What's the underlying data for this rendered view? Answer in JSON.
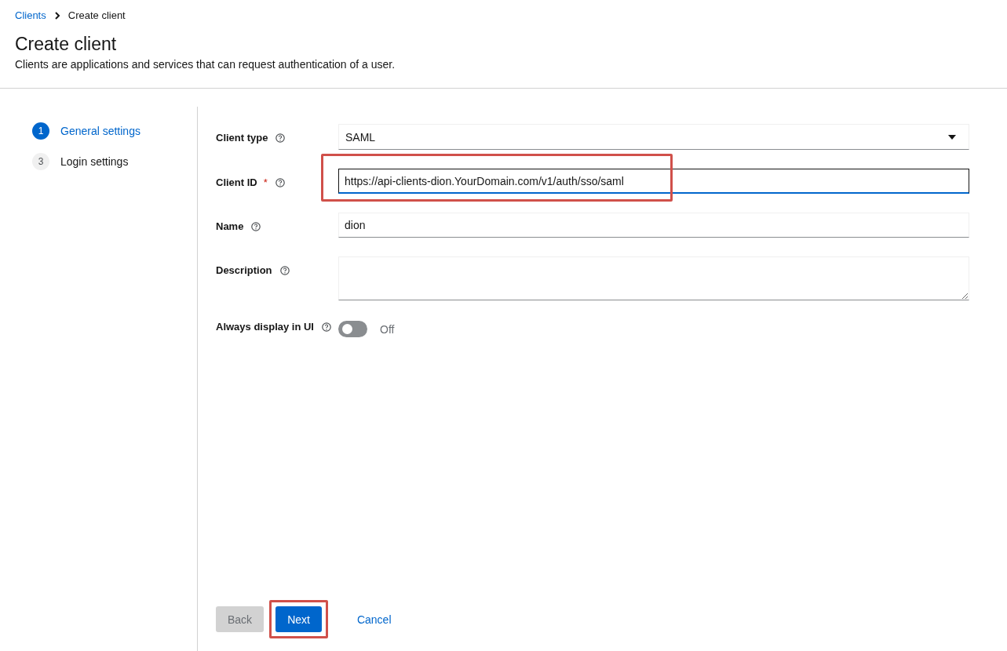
{
  "breadcrumb": [
    {
      "kind": "link",
      "label": "Clients"
    },
    {
      "kind": "current",
      "label": "Create client"
    }
  ],
  "header": {
    "title": "Create client",
    "description": "Clients are applications and services that can request authentication of a user."
  },
  "steps": [
    {
      "number": "1",
      "label": "General settings",
      "selected": true
    },
    {
      "number": "3",
      "label": "Login settings",
      "selected": false
    }
  ],
  "fields": [
    {
      "kind": "select",
      "label": "Client type",
      "value": "SAML",
      "highlighted": false,
      "focused": false
    },
    {
      "kind": "text",
      "label": "Client ID",
      "required_mark": "*",
      "value": "https://api-clients-dion.YourDomain.com/v1/auth/sso/saml",
      "highlighted": true,
      "focused": true
    },
    {
      "kind": "text",
      "label": "Name",
      "value": "dion",
      "highlighted": false,
      "focused": false
    },
    {
      "kind": "textarea",
      "label": "Description",
      "highlighted": false,
      "focused": false
    },
    {
      "kind": "toggle",
      "label": "Always display in UI",
      "on": false,
      "state_label": "Off",
      "highlighted": false
    }
  ],
  "buttons": [
    {
      "kind": "secondary",
      "label": "Back",
      "disabled": true,
      "highlighted": false
    },
    {
      "kind": "primary",
      "label": "Next",
      "disabled": false,
      "highlighted": true
    },
    {
      "kind": "link",
      "label": "Cancel",
      "disabled": false,
      "highlighted": false
    }
  ]
}
